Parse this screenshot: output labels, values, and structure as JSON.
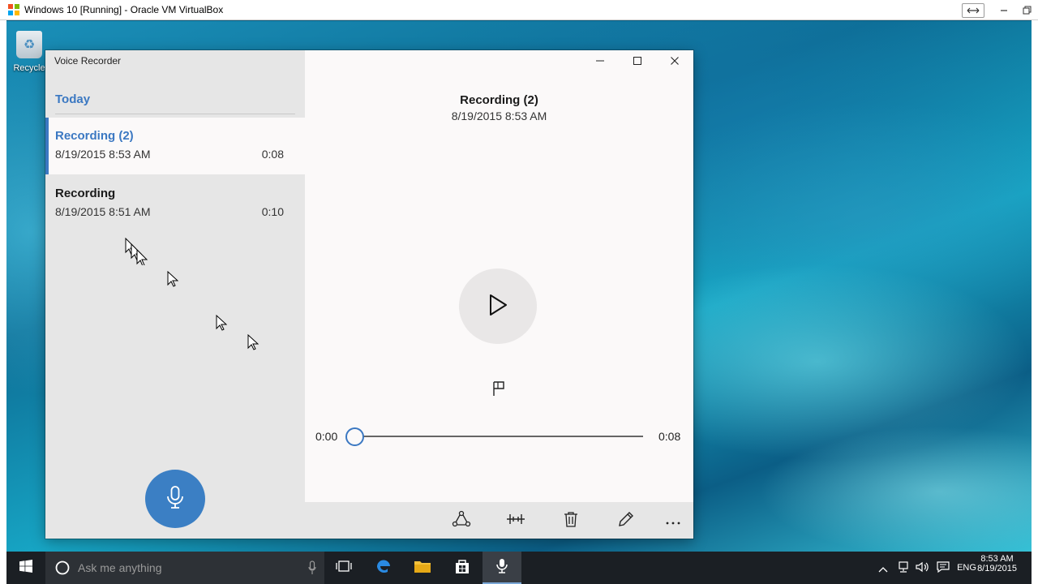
{
  "host": {
    "title": "Windows 10 [Running] - Oracle VM VirtualBox"
  },
  "desktop": {
    "recycle_bin_label": "Recycle"
  },
  "app": {
    "title": "Voice Recorder",
    "section_header": "Today",
    "recordings": [
      {
        "name": "Recording (2)",
        "date": "8/19/2015 8:53 AM",
        "duration": "0:08",
        "selected": true
      },
      {
        "name": "Recording",
        "date": "8/19/2015 8:51 AM",
        "duration": "0:10",
        "selected": false
      }
    ],
    "detail": {
      "title": "Recording (2)",
      "date": "8/19/2015 8:53 AM",
      "time_current": "0:00",
      "time_total": "0:08",
      "progress": 0
    },
    "commands": [
      "share-icon",
      "trim-icon",
      "delete-icon",
      "rename-icon",
      "more-icon"
    ]
  },
  "taskbar": {
    "search_placeholder": "Ask me anything",
    "language": "ENG",
    "time": "8:53 AM",
    "date": "8/19/2015"
  },
  "colors": {
    "accent": "#3b78c2",
    "record_button": "#3b7fc4",
    "taskbar": "#1b1f24"
  }
}
